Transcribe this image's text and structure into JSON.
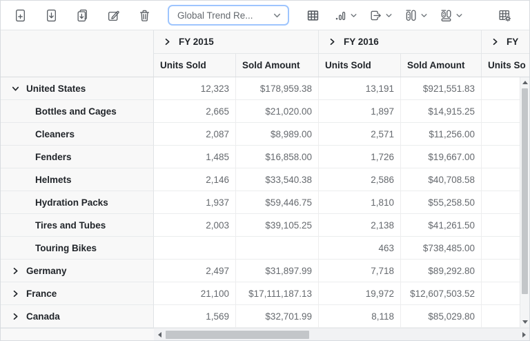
{
  "toolbar": {
    "report_dropdown": {
      "value": "Global Trend Re...",
      "icon": "chevron-down-icon"
    },
    "icons": [
      "new-report-icon",
      "save-report-icon",
      "save-as-report-icon",
      "rename-report-icon",
      "remove-report-icon",
      "grid-view-icon",
      "chart-view-icon",
      "export-icon",
      "subtotal-icon",
      "grandtotal-icon",
      "field-list-icon"
    ]
  },
  "colors": {
    "dropdown_focus_border": "#9ec5fe",
    "header_background": "#f8f8f8",
    "header_text": "#21252a",
    "value_text": "#65696e",
    "icon_gray": "#585d63",
    "scrollbar_thumb": "#c3c6c9"
  },
  "grid": {
    "corner_label": "",
    "column_groups": [
      {
        "label": "FY 2015",
        "state": "collapsed"
      },
      {
        "label": "FY 2016",
        "state": "collapsed"
      },
      {
        "label": "FY",
        "state": "collapsed",
        "clipped": true
      }
    ],
    "value_headers": [
      "Units Sold",
      "Sold Amount",
      "Units Sold",
      "Sold Amount",
      "Units So"
    ],
    "rows": [
      {
        "label": "United States",
        "level": 0,
        "expander": "expanded",
        "values": [
          "12,323",
          "$178,959.38",
          "13,191",
          "$921,551.83",
          ""
        ]
      },
      {
        "label": "Bottles and Cages",
        "level": 1,
        "expander": null,
        "values": [
          "2,665",
          "$21,020.00",
          "1,897",
          "$14,915.25",
          ""
        ]
      },
      {
        "label": "Cleaners",
        "level": 1,
        "expander": null,
        "values": [
          "2,087",
          "$8,989.00",
          "2,571",
          "$11,256.00",
          ""
        ]
      },
      {
        "label": "Fenders",
        "level": 1,
        "expander": null,
        "values": [
          "1,485",
          "$16,858.00",
          "1,726",
          "$19,667.00",
          ""
        ]
      },
      {
        "label": "Helmets",
        "level": 1,
        "expander": null,
        "values": [
          "2,146",
          "$33,540.38",
          "2,586",
          "$40,708.58",
          ""
        ]
      },
      {
        "label": "Hydration Packs",
        "level": 1,
        "expander": null,
        "values": [
          "1,937",
          "$59,446.75",
          "1,810",
          "$55,258.50",
          ""
        ]
      },
      {
        "label": "Tires and Tubes",
        "level": 1,
        "expander": null,
        "values": [
          "2,003",
          "$39,105.25",
          "2,138",
          "$41,261.50",
          ""
        ]
      },
      {
        "label": "Touring Bikes",
        "level": 1,
        "expander": null,
        "values": [
          "",
          "",
          "463",
          "$738,485.00",
          ""
        ]
      },
      {
        "label": "Germany",
        "level": 0,
        "expander": "collapsed",
        "values": [
          "2,497",
          "$31,897.99",
          "7,718",
          "$89,292.80",
          ""
        ]
      },
      {
        "label": "France",
        "level": 0,
        "expander": "collapsed",
        "values": [
          "21,100",
          "$17,111,187.13",
          "19,972",
          "$12,607,503.52",
          ""
        ]
      },
      {
        "label": "Canada",
        "level": 0,
        "expander": "collapsed",
        "values": [
          "1,569",
          "$32,701.99",
          "8,118",
          "$85,029.80",
          ""
        ]
      }
    ]
  }
}
